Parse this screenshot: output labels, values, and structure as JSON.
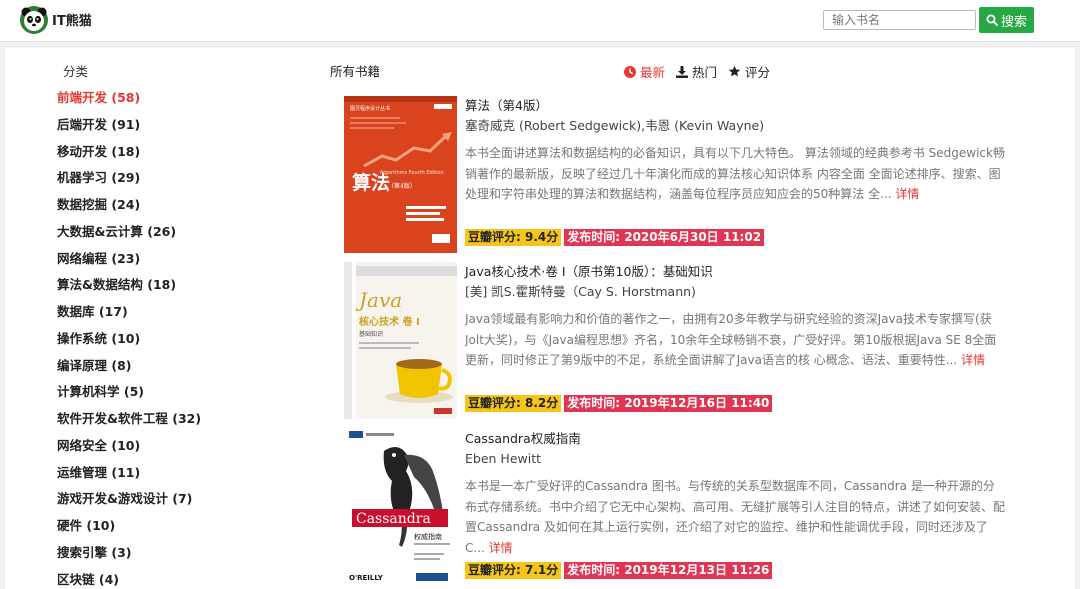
{
  "header": {
    "brand": "IT熊猫",
    "search_placeholder": "输入书名",
    "search_label": "搜索"
  },
  "sidebar": {
    "heading": "分类",
    "categories": [
      {
        "label": "前端开发 (58)"
      },
      {
        "label": "后端开发 (91)"
      },
      {
        "label": "移动开发 (18)"
      },
      {
        "label": "机器学习 (29)"
      },
      {
        "label": "数据挖掘 (24)"
      },
      {
        "label": "大数据&云计算 (26)"
      },
      {
        "label": "网络编程 (23)"
      },
      {
        "label": "算法&数据结构 (18)"
      },
      {
        "label": "数据库 (17)"
      },
      {
        "label": "操作系统 (10)"
      },
      {
        "label": "编译原理 (8)"
      },
      {
        "label": "计算机科学 (5)"
      },
      {
        "label": "软件开发&软件工程 (32)"
      },
      {
        "label": "网络安全 (10)"
      },
      {
        "label": "运维管理 (11)"
      },
      {
        "label": "游戏开发&游戏设计 (7)"
      },
      {
        "label": "硬件 (10)"
      },
      {
        "label": "搜索引擎 (3)"
      },
      {
        "label": "区块链 (4)"
      }
    ]
  },
  "content": {
    "heading": "所有书籍",
    "sorts": [
      {
        "label": "最新"
      },
      {
        "label": "热门"
      },
      {
        "label": "评分"
      }
    ],
    "more_label": "详情",
    "books": [
      {
        "title": "算法（第4版）",
        "author": "塞奇威克 (Robert Sedgewick),韦恩 (Kevin Wayne)",
        "description": "本书全面讲述算法和数据结构的必备知识，具有以下几大特色。 算法领域的经典参考书 Sedgewick畅销著作的最新版，反映了经过几十年演化而成的算法核心知识体系  内容全面 全面论述排序、搜索、图处理和字符串处理的算法和数据结构，涵盖每位程序员应知应会的50种算法  全...",
        "score": "豆瓣评分: 9.4分",
        "time": "发布时间: 2020年6月30日 11:02",
        "cover": {
          "title": "算法",
          "subtitle": "Algorithms Fourth Edition",
          "edition": "（第4版）",
          "top": "图灵程序设计丛书",
          "color": "#d9431e"
        }
      },
      {
        "title": "Java核心技术·卷 I（原书第10版）：基础知识",
        "author": "[美] 凯S.霍斯特曼（Cay S. Horstmann)",
        "description": "Java领域最有影响力和价值的著作之一，由拥有20多年教学与研究经验的资深Java技术专家撰写(获Jolt大奖)，与《Java编程思想》齐名，10余年全球畅销不衰，广受好评。第10版根据Java SE 8全面更新，同时修正了第9版中的不足，系统全面讲解了Java语言的核 心概念、语法、重要特性...",
        "score": "豆瓣评分: 8.2分",
        "time": "发布时间: 2019年12月16日 11:40",
        "cover": {
          "title": "Java",
          "subtitle": "核心技术 卷 I",
          "edition": "基础知识",
          "color": "#c9a227"
        }
      },
      {
        "title": "Cassandra权威指南",
        "author": "Eben Hewitt",
        "description": "本书是一本广受好评的Cassandra 图书。与传统的关系型数据库不同，Cassandra 是一种开源的分布式存储系统。书中介绍了它无中心架构、高可用、无缝扩展等引人注目的特点，讲述了如何安装、配置Cassandra 及如何在其上运行实例，还介绍了对它的监控、维护和性能调优手段，同时还涉及了C...",
        "score": "豆瓣评分: 7.1分",
        "time": "发布时间: 2019年12月13日 11:26",
        "cover": {
          "title": "Cassandra",
          "subtitle": "权威指南",
          "publisher": "O'REILLY",
          "color": "#c8102e"
        }
      }
    ]
  }
}
